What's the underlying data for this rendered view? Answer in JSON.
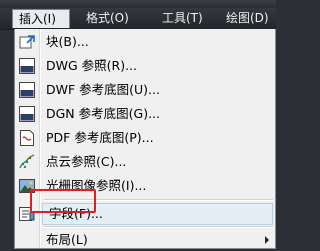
{
  "menubar": {
    "items": [
      {
        "label": "插入(I)",
        "active": true
      },
      {
        "label": "格式(O)",
        "active": false
      },
      {
        "label": "工具(T)",
        "active": false
      },
      {
        "label": "绘图(D)",
        "active": false
      }
    ]
  },
  "dropdown": {
    "items": [
      {
        "label": "块(B)...",
        "icon": "block-insert-icon"
      },
      {
        "label": "DWG 参照(R)...",
        "icon": "dwg-reference-icon",
        "icon_text": "DWG"
      },
      {
        "label": "DWF 参考底图(U)...",
        "icon": "dwf-underlay-icon",
        "icon_text": "DWF"
      },
      {
        "label": "DGN 参考底图(G)...",
        "icon": "dgn-underlay-icon",
        "icon_text": "DGN"
      },
      {
        "label": "PDF 参考底图(P)...",
        "icon": "pdf-underlay-icon",
        "icon_text": "PDF"
      },
      {
        "label": "点云参照(C)...",
        "icon": "point-cloud-icon"
      },
      {
        "label": "光栅图像参照(I)...",
        "icon": "raster-image-icon"
      },
      {
        "label": "字段(F)...",
        "icon": "field-icon",
        "highlighted": true
      },
      {
        "label": "布局(L)",
        "icon": "",
        "submenu": true
      }
    ]
  },
  "colors": {
    "highlight_border": "#e02020",
    "menubar_bg": "#2b2e34",
    "menu_bg": "#f0f0f0"
  }
}
